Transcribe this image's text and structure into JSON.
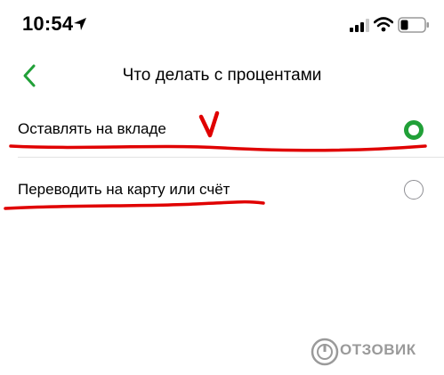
{
  "status_bar": {
    "time": "10:54",
    "icons": [
      "location-arrow-icon",
      "signal-icon",
      "wifi-icon",
      "battery-icon"
    ]
  },
  "nav": {
    "back_icon": "chevron-left-icon",
    "title": "Что делать с процентами"
  },
  "options": [
    {
      "label": "Оставлять на вкладе",
      "selected": true
    },
    {
      "label": "Переводить на карту или счёт",
      "selected": false
    }
  ],
  "colors": {
    "accent": "#21a038",
    "annotation": "#e00000",
    "radio_inactive": "#8e8e93"
  },
  "watermark": {
    "text": "ОТЗОВИК"
  }
}
